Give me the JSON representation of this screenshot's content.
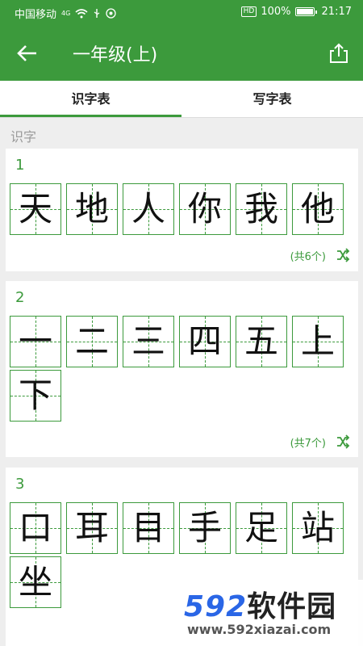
{
  "status_bar": {
    "carrier": "中国移动",
    "network": "4G",
    "hd": "HD",
    "battery": "100%",
    "time": "21:17"
  },
  "app_bar": {
    "title": "一年级(上)",
    "back_icon": "arrow-left-icon",
    "share_icon": "share-icon"
  },
  "tabs": [
    {
      "label": "识字表",
      "active": true
    },
    {
      "label": "写字表",
      "active": false
    }
  ],
  "section_label": "识字",
  "lessons": [
    {
      "number": "1",
      "chars": [
        "天",
        "地",
        "人",
        "你",
        "我",
        "他"
      ],
      "count": "(共6个)"
    },
    {
      "number": "2",
      "chars": [
        "一",
        "二",
        "三",
        "四",
        "五",
        "上",
        "下"
      ],
      "count": "(共7个)"
    },
    {
      "number": "3",
      "chars": [
        "口",
        "耳",
        "目",
        "手",
        "足",
        "站",
        "坐"
      ]
    }
  ],
  "watermark": {
    "brand_num": "592",
    "brand_cn": "软件园",
    "url": "www.592xiazai.com"
  },
  "colors": {
    "accent": "#3c9a3c",
    "watermark_blue": "#2a66e6"
  }
}
